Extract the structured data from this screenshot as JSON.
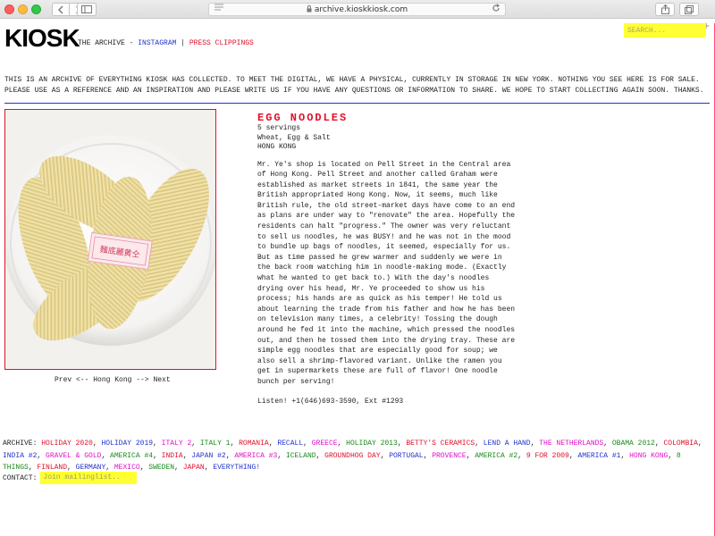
{
  "browser": {
    "url": "archive.kioskkiosk.com"
  },
  "header": {
    "logo": "KIOSK",
    "nav": [
      {
        "label": "THE ARCHIVE",
        "color": "#222222"
      },
      {
        "label": "INSTAGRAM",
        "color": "#2233cc"
      },
      {
        "label": "PRESS CLIPPINGS",
        "color": "#e0102a"
      }
    ],
    "nav_sep1": " - ",
    "nav_sep2": " | ",
    "search_placeholder": "SEARCH..."
  },
  "intro": "THIS IS AN ARCHIVE OF EVERYTHING KIOSK HAS COLLECTED. TO MEET THE DIGITAL, WE HAVE A PHYSICAL, CURRENTLY IN STORAGE IN NEW YORK. NOTHING YOU SEE HERE IS FOR SALE. PLEASE USE AS A REFERENCE AND AN INSPIRATION AND PLEASE WRITE US IF YOU HAVE ANY QUESTIONS OR INFORMATION TO SHARE. WE HOPE TO START COLLECTING AGAIN SOON. THANKS.",
  "item": {
    "title": "EGG NOODLES",
    "servings": "5 servings",
    "ingredients": "Wheat, Egg & Salt",
    "origin": "HONG KONG",
    "description": "Mr. Ye's shop is located on Pell Street in the Central area of Hong Kong. Pell Street and another called Graham were established as market streets in 1841, the same year the British appropriated Hong Kong. Now, it seems, much like British rule, the old street-market days have come to an end as plans are under way to \"renovate\" the area. Hopefully the residents can halt \"progress.\" The owner was very reluctant to sell us noodles, he was BUSY! and he was not in the mood to bundle up bags of noodles, it seemed, especially for us. But as time passed he grew warmer and suddenly we were in the back room watching him in noodle-making mode. (Exactly what he wanted to get back to.) With the day's noodles drying over his head, Mr. Ye proceeded to show us his process; his hands are as quick as his temper! He told us about learning the trade from his father and how he has been on television many times, a celebrity! Tossing the dough around he fed it into the machine, which pressed the noodles out, and then he tossed them into the drying tray. These are simple egg noodles that are especially good for soup; we also sell a shrimp-flavored variant. Unlike the ramen you get in supermarkets these are full of flavor! One noodle bunch per serving!",
    "phone": "Listen! +1(646)693-3590, Ext #1293",
    "image_label": "麵底麗黄仝"
  },
  "pager": {
    "prev": "Prev",
    "left_arrow": " <-- ",
    "region": "Hong Kong",
    "right_arrow": " --> ",
    "next": "Next"
  },
  "archive": {
    "label": "ARCHIVE:",
    "links": [
      {
        "label": "HOLIDAY 2020",
        "color": "#e0102a"
      },
      {
        "label": "HOLIDAY 2019",
        "color": "#2233cc"
      },
      {
        "label": "ITALY 2",
        "color": "#e010c8"
      },
      {
        "label": "ITALY 1",
        "color": "#1a8a1a"
      },
      {
        "label": "ROMANIA",
        "color": "#e0102a"
      },
      {
        "label": "RECALL",
        "color": "#2233cc"
      },
      {
        "label": "GREECE",
        "color": "#e010c8"
      },
      {
        "label": "HOLIDAY 2013",
        "color": "#1a8a1a"
      },
      {
        "label": "BETTY'S CERAMICS",
        "color": "#e0102a"
      },
      {
        "label": "LEND A HAND",
        "color": "#2233cc"
      },
      {
        "label": "THE NETHERLANDS",
        "color": "#e010c8"
      },
      {
        "label": "OBAMA 2012",
        "color": "#1a8a1a"
      },
      {
        "label": "COLOMBIA",
        "color": "#e0102a"
      },
      {
        "label": "INDIA #2",
        "color": "#2233cc"
      },
      {
        "label": "GRAVEL & GOLD",
        "color": "#e010c8"
      },
      {
        "label": "AMERICA #4",
        "color": "#1a8a1a"
      },
      {
        "label": "INDIA",
        "color": "#e0102a"
      },
      {
        "label": "JAPAN #2",
        "color": "#2233cc"
      },
      {
        "label": "AMERICA #3",
        "color": "#e010c8"
      },
      {
        "label": "ICELAND",
        "color": "#1a8a1a"
      },
      {
        "label": "GROUNDHOG DAY",
        "color": "#e0102a"
      },
      {
        "label": "PORTUGAL",
        "color": "#2233cc"
      },
      {
        "label": "PROVENCE",
        "color": "#e010c8"
      },
      {
        "label": "AMERICA #2",
        "color": "#1a8a1a"
      },
      {
        "label": "9 FOR 2009",
        "color": "#e0102a"
      },
      {
        "label": "AMERICA #1",
        "color": "#2233cc"
      },
      {
        "label": "HONG KONG",
        "color": "#e010c8"
      },
      {
        "label": "8 THINGS",
        "color": "#1a8a1a"
      },
      {
        "label": "FINLAND",
        "color": "#e0102a"
      },
      {
        "label": "GERMANY",
        "color": "#2233cc"
      },
      {
        "label": "MEXICO",
        "color": "#e010c8"
      },
      {
        "label": "SWEDEN",
        "color": "#1a8a1a"
      },
      {
        "label": "JAPAN",
        "color": "#e0102a"
      },
      {
        "label": "EVERYTHING!",
        "color": "#2233cc"
      }
    ]
  },
  "contact": {
    "label": "CONTACT:",
    "mailing_label": "Join mailinglist.."
  },
  "colors": {
    "accent_red": "#e0102a",
    "accent_blue": "#2233cc",
    "highlight_yellow": "#ffff33"
  }
}
